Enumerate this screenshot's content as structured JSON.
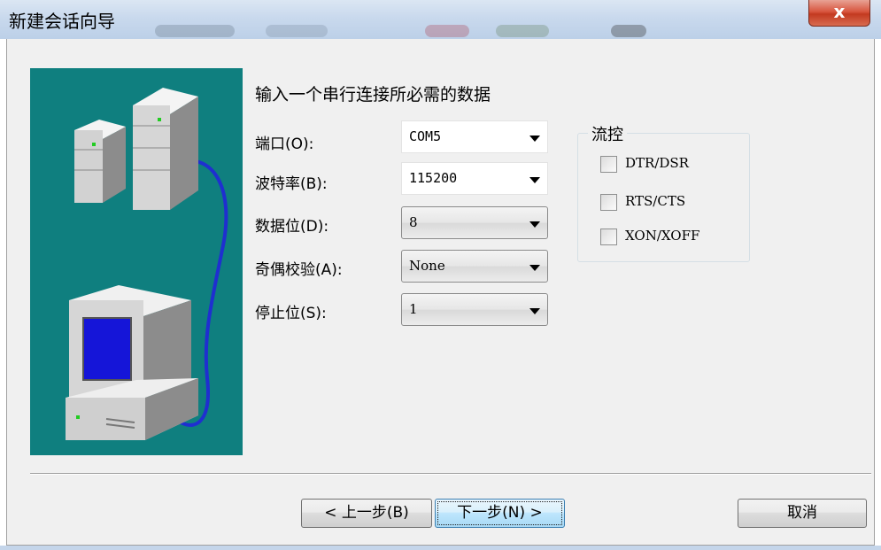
{
  "window": {
    "title": "新建会话向导",
    "close_glyph": "x"
  },
  "heading": "输入一个串行连接所必需的数据",
  "fields": [
    {
      "label": "端口(O):",
      "value": "COM5"
    },
    {
      "label": "波特率(B):",
      "value": "115200"
    },
    {
      "label": "数据位(D):",
      "value": "8"
    },
    {
      "label": "奇偶校验(A):",
      "value": "None"
    },
    {
      "label": "停止位(S):",
      "value": "1"
    }
  ],
  "flow_control": {
    "title": "流控",
    "options": [
      {
        "label": "DTR/DSR",
        "checked": false
      },
      {
        "label": "RTS/CTS",
        "checked": false
      },
      {
        "label": "XON/XOFF",
        "checked": false
      }
    ]
  },
  "buttons": {
    "back": "< 上一步(B)",
    "next": "下一步(N) >",
    "cancel": "取消"
  },
  "colors": {
    "art_background": "#0f7f7f",
    "cable": "#1f2fd0",
    "monitor_screen": "#1515d8"
  }
}
